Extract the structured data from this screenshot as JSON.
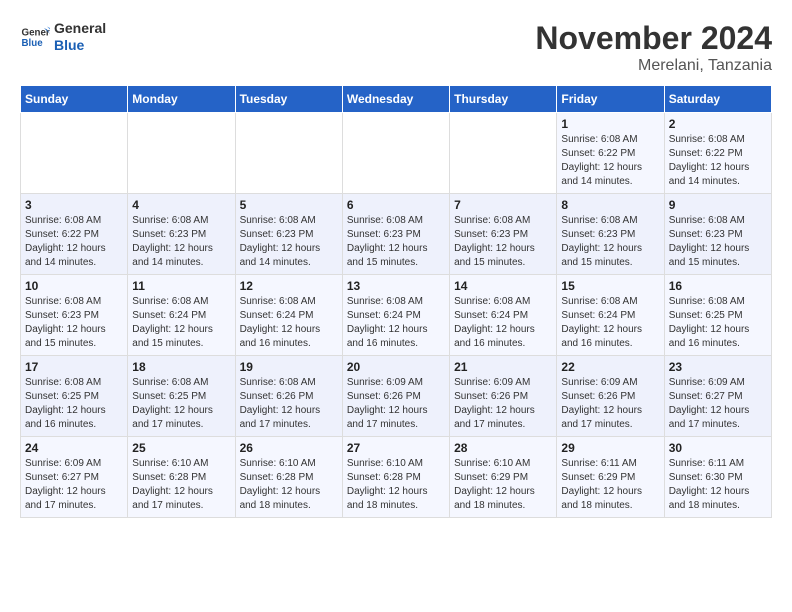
{
  "logo": {
    "general": "General",
    "blue": "Blue"
  },
  "header": {
    "month": "November 2024",
    "location": "Merelani, Tanzania"
  },
  "weekdays": [
    "Sunday",
    "Monday",
    "Tuesday",
    "Wednesday",
    "Thursday",
    "Friday",
    "Saturday"
  ],
  "weeks": [
    [
      {
        "day": "",
        "info": ""
      },
      {
        "day": "",
        "info": ""
      },
      {
        "day": "",
        "info": ""
      },
      {
        "day": "",
        "info": ""
      },
      {
        "day": "",
        "info": ""
      },
      {
        "day": "1",
        "info": "Sunrise: 6:08 AM\nSunset: 6:22 PM\nDaylight: 12 hours and 14 minutes."
      },
      {
        "day": "2",
        "info": "Sunrise: 6:08 AM\nSunset: 6:22 PM\nDaylight: 12 hours and 14 minutes."
      }
    ],
    [
      {
        "day": "3",
        "info": "Sunrise: 6:08 AM\nSunset: 6:22 PM\nDaylight: 12 hours and 14 minutes."
      },
      {
        "day": "4",
        "info": "Sunrise: 6:08 AM\nSunset: 6:23 PM\nDaylight: 12 hours and 14 minutes."
      },
      {
        "day": "5",
        "info": "Sunrise: 6:08 AM\nSunset: 6:23 PM\nDaylight: 12 hours and 14 minutes."
      },
      {
        "day": "6",
        "info": "Sunrise: 6:08 AM\nSunset: 6:23 PM\nDaylight: 12 hours and 15 minutes."
      },
      {
        "day": "7",
        "info": "Sunrise: 6:08 AM\nSunset: 6:23 PM\nDaylight: 12 hours and 15 minutes."
      },
      {
        "day": "8",
        "info": "Sunrise: 6:08 AM\nSunset: 6:23 PM\nDaylight: 12 hours and 15 minutes."
      },
      {
        "day": "9",
        "info": "Sunrise: 6:08 AM\nSunset: 6:23 PM\nDaylight: 12 hours and 15 minutes."
      }
    ],
    [
      {
        "day": "10",
        "info": "Sunrise: 6:08 AM\nSunset: 6:23 PM\nDaylight: 12 hours and 15 minutes."
      },
      {
        "day": "11",
        "info": "Sunrise: 6:08 AM\nSunset: 6:24 PM\nDaylight: 12 hours and 15 minutes."
      },
      {
        "day": "12",
        "info": "Sunrise: 6:08 AM\nSunset: 6:24 PM\nDaylight: 12 hours and 16 minutes."
      },
      {
        "day": "13",
        "info": "Sunrise: 6:08 AM\nSunset: 6:24 PM\nDaylight: 12 hours and 16 minutes."
      },
      {
        "day": "14",
        "info": "Sunrise: 6:08 AM\nSunset: 6:24 PM\nDaylight: 12 hours and 16 minutes."
      },
      {
        "day": "15",
        "info": "Sunrise: 6:08 AM\nSunset: 6:24 PM\nDaylight: 12 hours and 16 minutes."
      },
      {
        "day": "16",
        "info": "Sunrise: 6:08 AM\nSunset: 6:25 PM\nDaylight: 12 hours and 16 minutes."
      }
    ],
    [
      {
        "day": "17",
        "info": "Sunrise: 6:08 AM\nSunset: 6:25 PM\nDaylight: 12 hours and 16 minutes."
      },
      {
        "day": "18",
        "info": "Sunrise: 6:08 AM\nSunset: 6:25 PM\nDaylight: 12 hours and 17 minutes."
      },
      {
        "day": "19",
        "info": "Sunrise: 6:08 AM\nSunset: 6:26 PM\nDaylight: 12 hours and 17 minutes."
      },
      {
        "day": "20",
        "info": "Sunrise: 6:09 AM\nSunset: 6:26 PM\nDaylight: 12 hours and 17 minutes."
      },
      {
        "day": "21",
        "info": "Sunrise: 6:09 AM\nSunset: 6:26 PM\nDaylight: 12 hours and 17 minutes."
      },
      {
        "day": "22",
        "info": "Sunrise: 6:09 AM\nSunset: 6:26 PM\nDaylight: 12 hours and 17 minutes."
      },
      {
        "day": "23",
        "info": "Sunrise: 6:09 AM\nSunset: 6:27 PM\nDaylight: 12 hours and 17 minutes."
      }
    ],
    [
      {
        "day": "24",
        "info": "Sunrise: 6:09 AM\nSunset: 6:27 PM\nDaylight: 12 hours and 17 minutes."
      },
      {
        "day": "25",
        "info": "Sunrise: 6:10 AM\nSunset: 6:28 PM\nDaylight: 12 hours and 17 minutes."
      },
      {
        "day": "26",
        "info": "Sunrise: 6:10 AM\nSunset: 6:28 PM\nDaylight: 12 hours and 18 minutes."
      },
      {
        "day": "27",
        "info": "Sunrise: 6:10 AM\nSunset: 6:28 PM\nDaylight: 12 hours and 18 minutes."
      },
      {
        "day": "28",
        "info": "Sunrise: 6:10 AM\nSunset: 6:29 PM\nDaylight: 12 hours and 18 minutes."
      },
      {
        "day": "29",
        "info": "Sunrise: 6:11 AM\nSunset: 6:29 PM\nDaylight: 12 hours and 18 minutes."
      },
      {
        "day": "30",
        "info": "Sunrise: 6:11 AM\nSunset: 6:30 PM\nDaylight: 12 hours and 18 minutes."
      }
    ]
  ]
}
